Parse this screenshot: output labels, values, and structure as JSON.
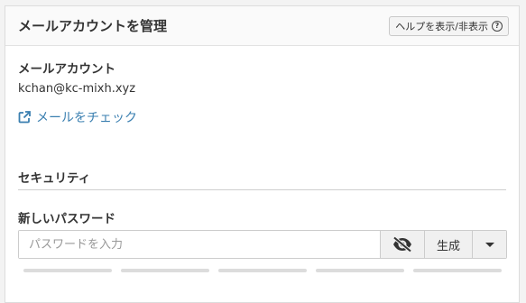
{
  "header": {
    "title": "メールアカウントを管理",
    "help_label": "ヘルプを表示/非表示",
    "help_icon": "question-circle-icon"
  },
  "account": {
    "heading": "メールアカウント",
    "email": "kchan@kc-mixh.xyz",
    "check_link": "メールをチェック",
    "check_icon": "external-link-icon"
  },
  "security": {
    "heading": "セキュリティ",
    "new_password_label": "新しいパスワード",
    "password_placeholder": "パスワードを入力",
    "password_value": "",
    "visibility_icon": "eye-slash-icon",
    "generate_label": "生成",
    "menu_icon": "caret-down-icon",
    "strength_level": 0
  },
  "colors": {
    "link": "#3a7fb0",
    "strength_empty": "#dcdcdc"
  }
}
